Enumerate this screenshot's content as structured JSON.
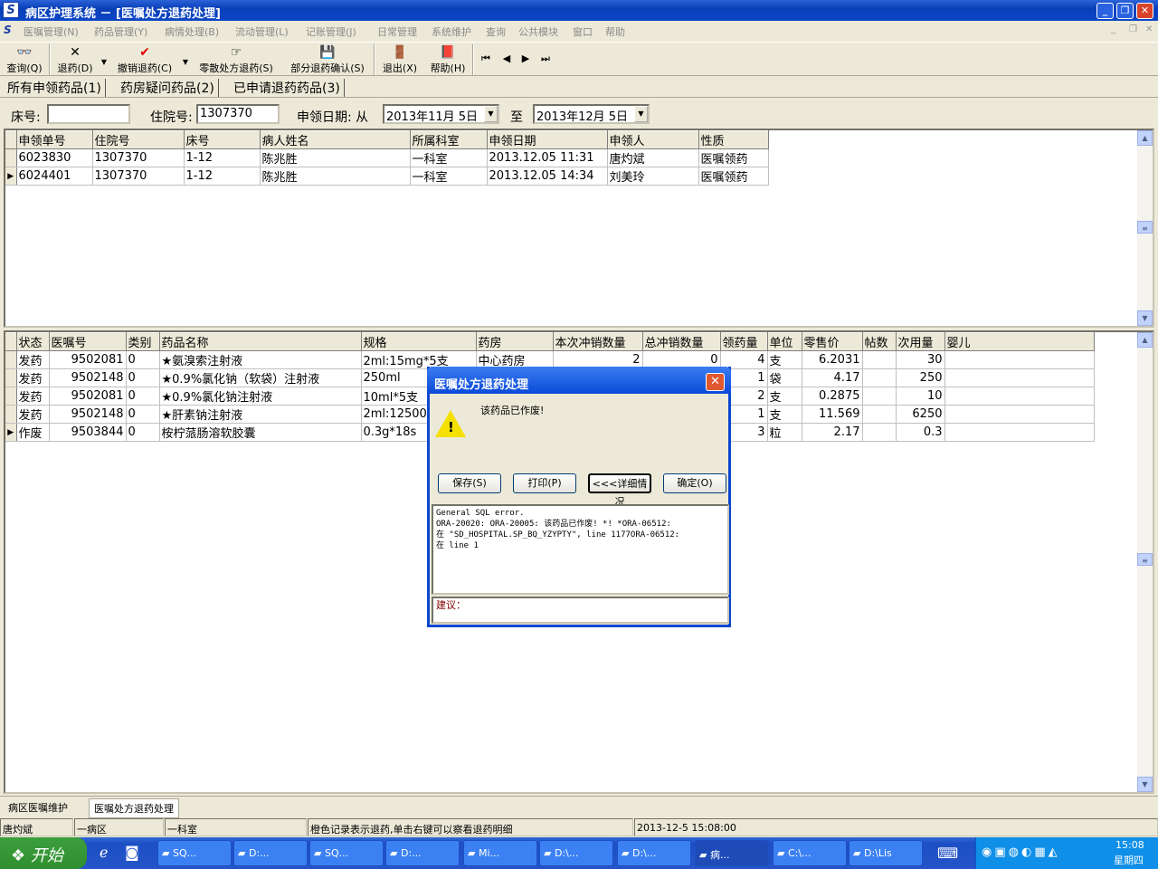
{
  "window": {
    "title": "病区护理系统 － [医嘱处方退药处理]",
    "logo": "S"
  },
  "menu": [
    "医嘱管理(N)",
    "药品管理(Y)",
    "病情处理(B)",
    "流动管理(L)",
    "记账管理(J)",
    "日常管理",
    "系统维护",
    "查询",
    "公共模块",
    "窗口",
    "帮助"
  ],
  "toolbar": {
    "query": "查询(Q)",
    "return": "退药(D)",
    "cancel_return": "撤销退药(C)",
    "scatter_return": "零散处方退药(S)",
    "partial_confirm": "部分退药确认(S)",
    "exit": "退出(X)",
    "help": "帮助(H)"
  },
  "tabs": [
    "所有申领药品(1)",
    "药房疑问药品(2)",
    "已申请退药药品(3)"
  ],
  "filters": {
    "bed_label": "床号:",
    "bed_value": "",
    "inpatient_label": "住院号:",
    "inpatient_value": "1307370",
    "date_label": "申领日期: 从",
    "date_from": "2013年11月 5日",
    "to_label": "至",
    "date_to": "2013年12月 5日"
  },
  "upper_grid": {
    "columns": [
      "申领单号",
      "住院号",
      "床号",
      "病人姓名",
      "所属科室",
      "申领日期",
      "申领人",
      "性质"
    ],
    "rows": [
      [
        "6023830",
        "1307370",
        "1-12",
        "陈兆胜",
        "一科室",
        "2013.12.05 11:31",
        "唐灼斌",
        "医嘱领药"
      ],
      [
        "6024401",
        "1307370",
        "1-12",
        "陈兆胜",
        "一科室",
        "2013.12.05 14:34",
        "刘美玲",
        "医嘱领药"
      ]
    ],
    "current_row": 1
  },
  "lower_grid": {
    "columns": [
      "状态",
      "医嘱号",
      "类别",
      "药品名称",
      "规格",
      "药房",
      "本次冲销数量",
      "总冲销数量",
      "领药量",
      "单位",
      "零售价",
      "帖数",
      "次用量",
      "婴儿"
    ],
    "rows": [
      [
        "发药",
        "9502081",
        "0",
        "★氨溴索注射液",
        "2ml:15mg*5支",
        "中心药房",
        "2",
        "0",
        "4",
        "支",
        "6.2031",
        "",
        "30",
        ""
      ],
      [
        "发药",
        "9502148",
        "0",
        "★0.9%氯化钠（软袋）注射液",
        "250ml",
        "",
        "",
        "",
        "1",
        "袋",
        "4.17",
        "",
        "250",
        ""
      ],
      [
        "发药",
        "9502081",
        "0",
        "★0.9%氯化钠注射液",
        "10ml*5支",
        "",
        "",
        "",
        "2",
        "支",
        "0.2875",
        "",
        "10",
        ""
      ],
      [
        "发药",
        "9502148",
        "0",
        "★肝素钠注射液",
        "2ml:12500",
        "",
        "",
        "",
        "1",
        "支",
        "11.569",
        "",
        "6250",
        ""
      ],
      [
        "作废",
        "9503844",
        "0",
        "桉柠蒎肠溶软胶囊",
        "0.3g*18s",
        "",
        "",
        "",
        "3",
        "粒",
        "2.17",
        "",
        "0.3",
        ""
      ]
    ],
    "current_row": 4
  },
  "dialog": {
    "title": "医嘱处方退药处理",
    "message": "该药品已作废!",
    "buttons": [
      "保存(S)",
      "打印(P)",
      "<<<详细情况",
      "确定(O)"
    ],
    "detail": "General SQL error.\nORA-20020: ORA-20005: 该药品已作废! *! *ORA-06512:\n在 \"SD_HOSPITAL.SP_BQ_YZYPTY\", line 1177ORA-06512:\n在 line 1",
    "suggestion": "建议："
  },
  "bottom_tabs": [
    "病区医嘱维护",
    "医嘱处方退药处理"
  ],
  "status": [
    "唐灼斌",
    "一病区",
    "一科室",
    "橙色记录表示退药,单击右键可以察看退药明细",
    "2013-12-5 15:08:00"
  ],
  "taskbar": {
    "start": "开始",
    "tasks": [
      "SQ...",
      "D:...",
      "SQ...",
      "D:...",
      "Mi...",
      "D:\\...",
      "D:\\...",
      "病...",
      "C:\\...",
      "D:\\Lis"
    ],
    "active_task": 7,
    "time": "15:08",
    "weekday": "星期四"
  }
}
